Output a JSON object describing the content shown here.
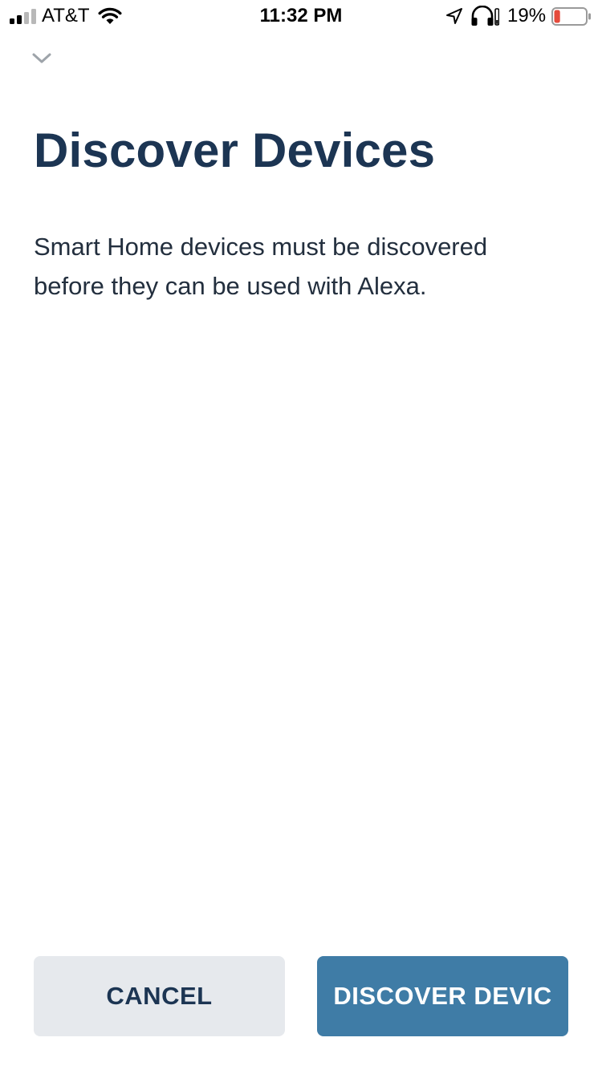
{
  "status_bar": {
    "carrier": "AT&T",
    "time": "11:32 PM",
    "battery_percent": "19%",
    "battery_level": 0.19,
    "battery_color": "#e54b3c",
    "icons": [
      "cellular-signal-icon",
      "wifi-icon",
      "location-arrow-icon",
      "headphones-icon",
      "battery-icon"
    ]
  },
  "header": {
    "collapse_icon": "chevron-down-icon",
    "title": "Discover Devices"
  },
  "main": {
    "description": "Smart Home devices must be discovered before they can be used with Alexa."
  },
  "actions": {
    "cancel_label": "CANCEL",
    "discover_label": "DISCOVER DEVIC"
  },
  "colors": {
    "title": "#1c3553",
    "primary_button": "#3f7ca6",
    "secondary_button": "#e6e9ed"
  }
}
